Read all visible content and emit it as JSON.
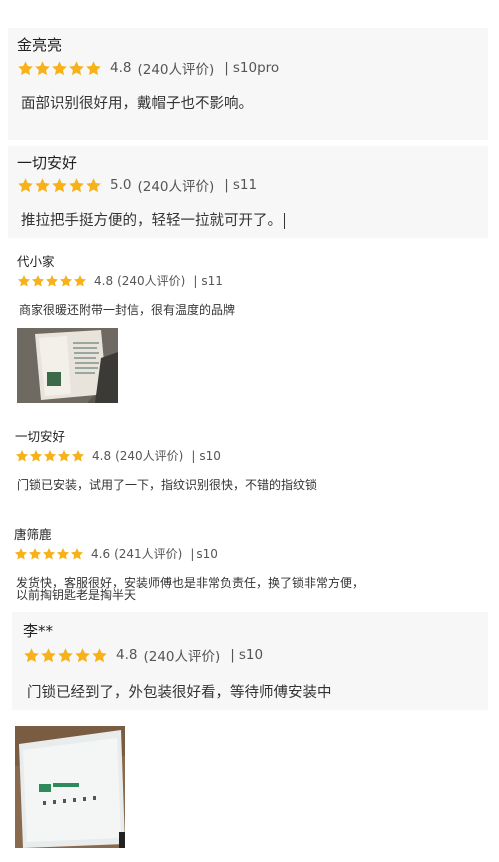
{
  "colors": {
    "star": "#f7b21a",
    "panel": "#f7f7f7"
  },
  "reviews": [
    {
      "name": "金亮亮",
      "score": "4.8",
      "count": "(240人评价)",
      "sep": "|",
      "model": "s10pro",
      "text": "面部识别很好用，戴帽子也不影响。",
      "stars": 5
    },
    {
      "name": "一切安好",
      "score": "5.0",
      "count": "(240人评价)",
      "sep": "|",
      "model": "s11",
      "text": "推拉把手挺方便的，轻轻一拉就可开了。",
      "stars": 5
    },
    {
      "name": "代小家",
      "score": "4.8",
      "count": "(240人评价)",
      "sep": "|",
      "model": "s11",
      "text": "商家很暖还附带一封信，很有温度的品牌",
      "stars": 5
    },
    {
      "name": "一切安好",
      "score": "4.8",
      "count": "(240人评价)",
      "sep": "|",
      "model": "s10",
      "text": "门锁已安装，试用了一下，指纹识别很快，不错的指纹锁",
      "stars": 5
    },
    {
      "name": "唐筛鹿",
      "score": "4.6",
      "count": "(241人评价)",
      "sep": "|",
      "model": "s10",
      "text": "发货快，客服很好，安装师傅也是非常负责任，换了锁非常方便，",
      "text2": "以前掏钥匙老是掏半天",
      "stars": 5
    },
    {
      "name": "李**",
      "score": "4.8",
      "count": "(240人评价)",
      "sep": "|",
      "model": "s10",
      "text": "门锁已经到了，外包装很好看，等待师傅安装中",
      "stars": 5
    }
  ]
}
